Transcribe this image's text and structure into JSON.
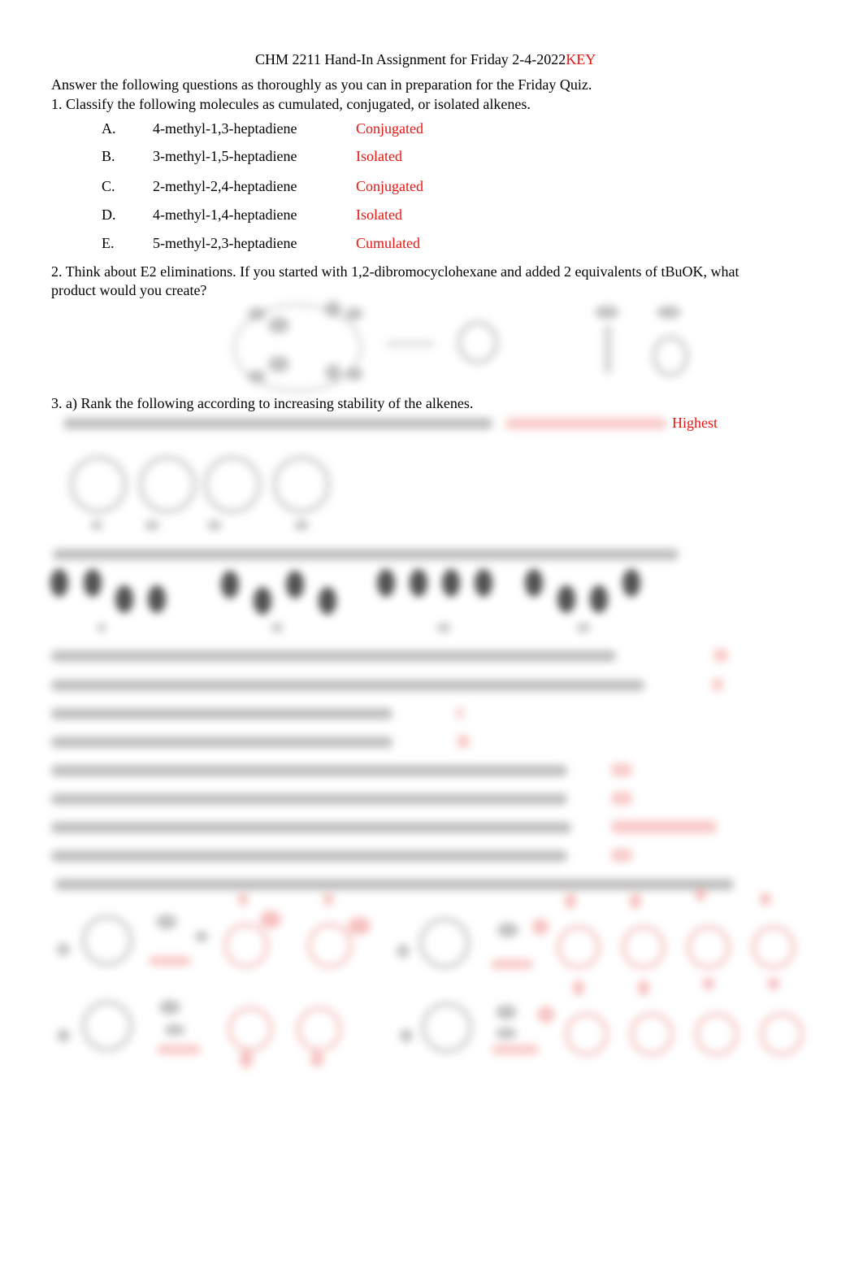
{
  "header": {
    "title": "CHM 2211 Hand-In Assignment for Friday 2-4-2022",
    "key_label": "KEY"
  },
  "intro": "Answer the following questions as thoroughly as you can in preparation for the Friday Quiz.",
  "q1": {
    "prompt": "1. Classify the following molecules as cumulated, conjugated, or isolated alkenes.",
    "items": [
      {
        "letter": "A.",
        "name": "4-methyl-1,3-heptadiene",
        "answer": "Conjugated"
      },
      {
        "letter": "B.",
        "name": "3-methyl-1,5-heptadiene",
        "answer": "Isolated"
      },
      {
        "letter": "C.",
        "name": "2-methyl-2,4-heptadiene",
        "answer": "Conjugated"
      },
      {
        "letter": "D.",
        "name": "4-methyl-1,4-heptadiene",
        "answer": "Isolated"
      },
      {
        "letter": "E.",
        "name": "5-methyl-2,3-heptadiene",
        "answer": "Cumulated"
      }
    ]
  },
  "q2": {
    "prompt_line1": "2. Think about E2 eliminations. If you started with 1,2-dibromocyclohexane and added 2 equivalents of tBuOK, what",
    "prompt_line2": "product would you create?"
  },
  "q3": {
    "prompt": "3. a) Rank the following according to increasing stability of the alkenes.",
    "rank_end_label": "Highest"
  },
  "colors": {
    "answer_red": "#e8140f",
    "text": "#000000"
  }
}
